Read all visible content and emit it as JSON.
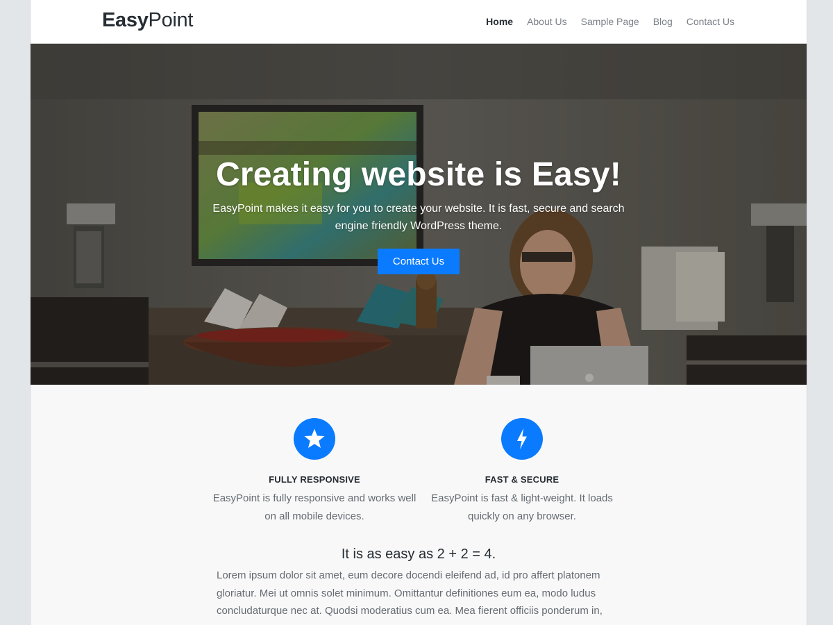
{
  "header": {
    "logo_bold": "Easy",
    "logo_light": "Point",
    "nav": [
      {
        "label": "Home",
        "active": true
      },
      {
        "label": "About Us",
        "active": false
      },
      {
        "label": "Sample Page",
        "active": false
      },
      {
        "label": "Blog",
        "active": false
      },
      {
        "label": "Contact Us",
        "active": false
      }
    ]
  },
  "hero": {
    "title": "Creating website is Easy!",
    "subtitle": "EasyPoint makes it easy for you to create your website. It is fast, secure and search engine friendly WordPress theme.",
    "button_label": "Contact Us"
  },
  "features": [
    {
      "icon": "star-icon",
      "title": "FULLY RESPONSIVE",
      "text": "EasyPoint is fully responsive and works well on all mobile devices."
    },
    {
      "icon": "lightning-bolt-icon",
      "title": "FAST & SECURE",
      "text": "EasyPoint is fast & light-weight. It loads quickly on any browser."
    }
  ],
  "about": {
    "title": "It is as easy as 2 + 2 = 4.",
    "text": "Lorem ipsum dolor sit amet, eum decore docendi eleifend ad, id pro affert platonem gloriatur. Mei ut omnis solet minimum. Omittantur definitiones eum ea, modo ludus concludaturque nec at. Quodsi moderatius cum ea. Mea fierent officiis ponderum in,"
  },
  "colors": {
    "accent": "#0a7bff",
    "heading": "#262d33",
    "body_text": "#656b72",
    "nav_text": "#7a8088",
    "page_bg": "#e3e6e8"
  }
}
